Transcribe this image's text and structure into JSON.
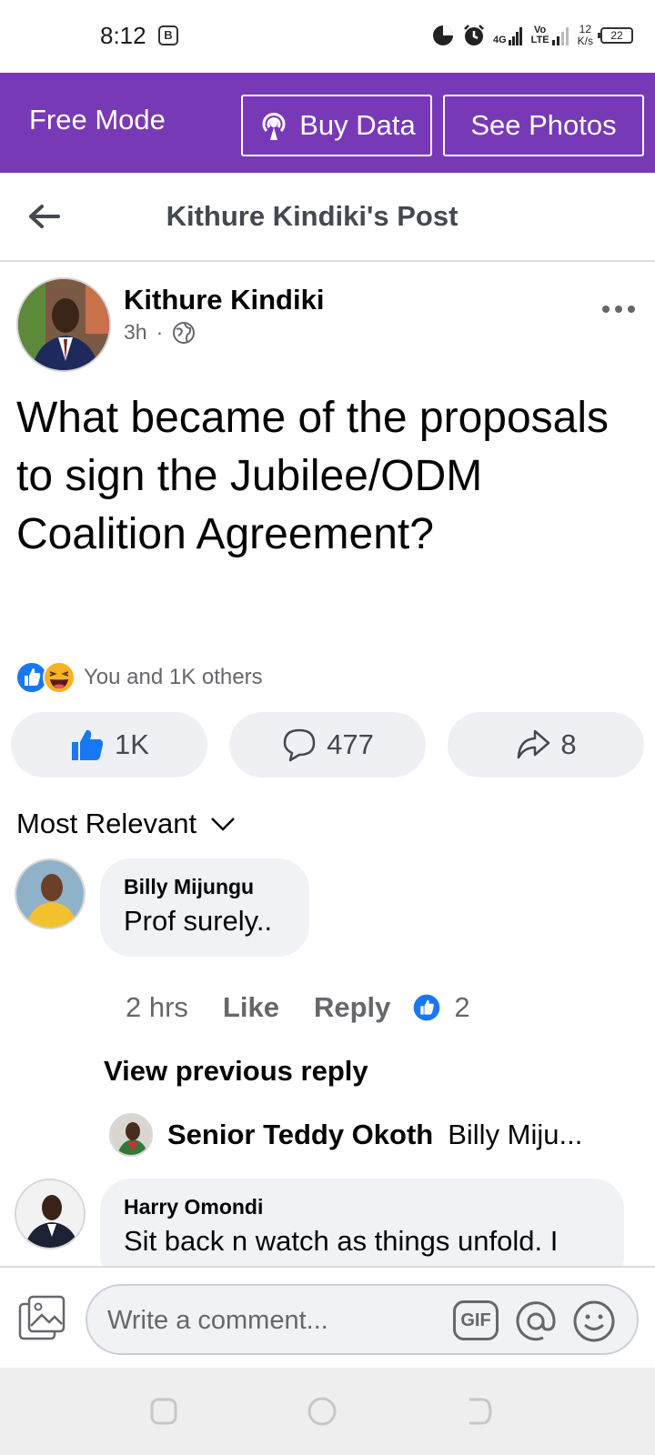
{
  "status_bar": {
    "time": "8:12",
    "badge": "B",
    "network": "4G",
    "volte": "Vo LTE",
    "speed_value": "12",
    "speed_unit": "K/s",
    "battery": "22"
  },
  "banner": {
    "title": "Free Mode",
    "buy_data_label": "Buy Data",
    "see_photos_label": "See Photos",
    "color": "#7839b6"
  },
  "header": {
    "title": "Kithure Kindiki's Post"
  },
  "post": {
    "author": "Kithure Kindiki",
    "time": "3h",
    "separator": "·",
    "text": "What became of the proposals to sign the Jubilee/ODM Coalition Agreement?",
    "reactions_text": "You and 1K others",
    "like_count": "1K",
    "comment_count": "477",
    "share_count": "8"
  },
  "sort": {
    "label": "Most Relevant"
  },
  "comments": [
    {
      "author": "Billy Mijungu",
      "text": "Prof surely..",
      "time": "2 hrs",
      "like_label": "Like",
      "reply_label": "Reply",
      "like_count": "2",
      "view_previous": "View previous reply",
      "reply": {
        "author": "Senior Teddy Okoth",
        "text": "Billy Miju..."
      }
    },
    {
      "author": "Harry Omondi",
      "text": "Sit back n watch as things unfold. I"
    }
  ],
  "composer": {
    "placeholder": "Write a comment...",
    "gif_label": "GIF"
  },
  "colors": {
    "facebook_blue": "#1877f2",
    "text_secondary": "#65676b",
    "bubble_bg": "#f0f2f5"
  }
}
